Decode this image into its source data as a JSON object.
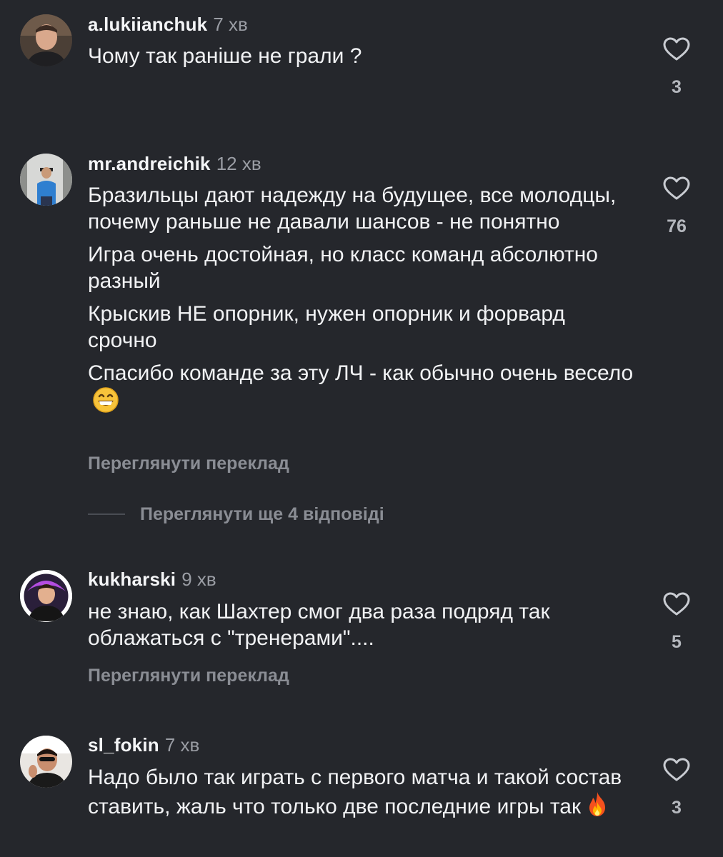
{
  "comments": [
    {
      "username": "a.lukiianchuk",
      "time": "7 хв",
      "paragraphs": [
        "Чому так раніше не грали ?"
      ],
      "likes": "3",
      "avatar_icon": "user-avatar"
    },
    {
      "username": "mr.andreichik",
      "time": "12 хв",
      "paragraphs": [
        "Бразильцы дают надежду на будущее, все молодцы, почему раньше не давали шансов - не понятно",
        "Игра очень достойная, но класс команд абсолютно разный",
        "Крыскив НЕ опорник, нужен опорник и форвард срочно",
        "Спасибо команде за эту ЛЧ - как обычно очень весело"
      ],
      "emoji_icon": "grinning-face-emoji",
      "translate_label": "Переглянути переклад",
      "likes": "76",
      "avatar_icon": "user-avatar"
    },
    {
      "username": "kukharski",
      "time": "9 хв",
      "paragraphs": [
        "не знаю, как Шахтер смог два раза подряд так облажаться с \"тренерами\"...."
      ],
      "translate_label": "Переглянути переклад",
      "likes": "5",
      "avatar_icon": "user-avatar"
    },
    {
      "username": "sl_fokin",
      "time": "7 хв",
      "paragraphs": [
        "Надо было так играть с первого матча и такой состав ставить, жаль что только две последние игры так"
      ],
      "emoji_icon": "fire-emoji",
      "likes": "3",
      "avatar_icon": "user-avatar"
    }
  ],
  "replies_label": "Переглянути ще 4 відповіді",
  "icons": {
    "like": "heart-outline-icon"
  },
  "colors": {
    "background": "#25272c",
    "text": "#f1f2f4",
    "muted": "#8a8d94"
  }
}
